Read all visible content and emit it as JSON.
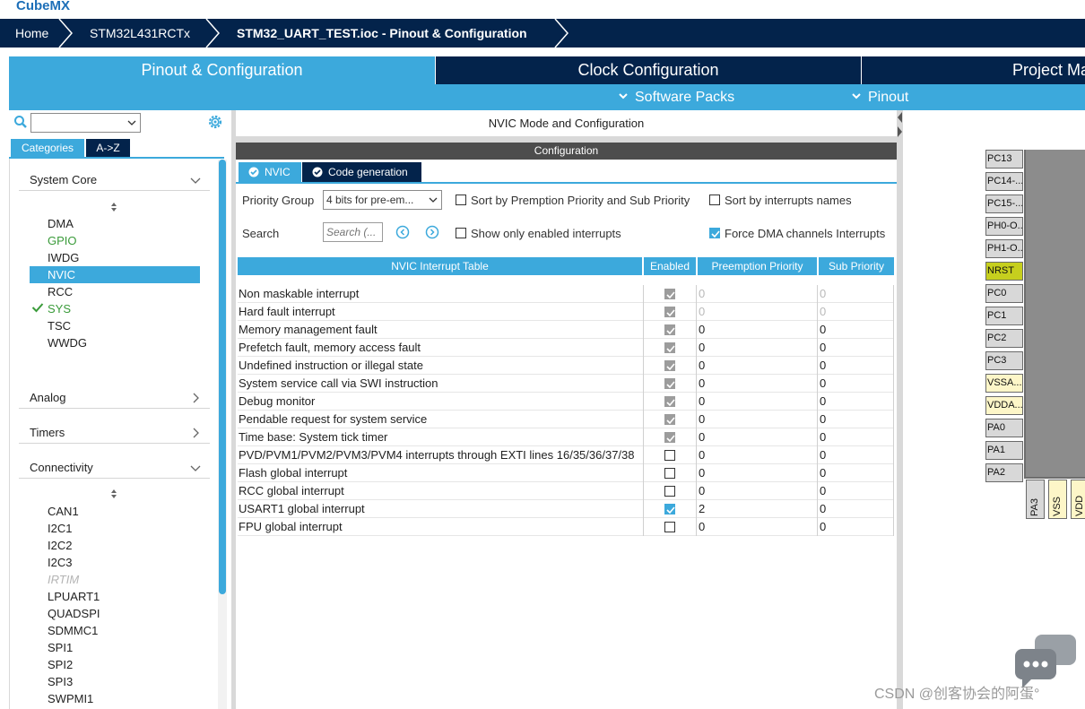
{
  "app": {
    "logo_text": "CubeMX"
  },
  "breadcrumb": {
    "home": "Home",
    "device": "STM32L431RCTx",
    "file": "STM32_UART_TEST.ioc - Pinout & Configuration"
  },
  "main_tabs": [
    {
      "label": "Pinout & Configuration",
      "active": true
    },
    {
      "label": "Clock Configuration",
      "active": false
    },
    {
      "label": "Project Ma",
      "active": false
    }
  ],
  "sub_menu": {
    "software_packs": "Software Packs",
    "pinout": "Pinout"
  },
  "left": {
    "tabs": {
      "categories": "Categories",
      "az": "A->Z"
    },
    "sections": {
      "system_core": "System Core",
      "analog": "Analog",
      "timers": "Timers",
      "connectivity": "Connectivity"
    },
    "system_core_items": [
      "DMA",
      "GPIO",
      "IWDG",
      "NVIC",
      "RCC",
      "SYS",
      "TSC",
      "WWDG"
    ],
    "connectivity_items": [
      "CAN1",
      "I2C1",
      "I2C2",
      "I2C3",
      "IRTIM",
      "LPUART1",
      "QUADSPI",
      "SDMMC1",
      "SPI1",
      "SPI2",
      "SPI3",
      "SWPMI1"
    ]
  },
  "center": {
    "mode_title": "NVIC Mode and Configuration",
    "config_title": "Configuration",
    "tabs": {
      "nvic": "NVIC",
      "codegen": "Code generation"
    },
    "priority_group_label": "Priority Group",
    "priority_group_value": "4 bits for pre-em...",
    "search_label": "Search",
    "search_placeholder": "Search (...",
    "options": {
      "sort_premption": {
        "label": "Sort by Premption Priority and Sub Priority",
        "checked": false
      },
      "sort_names": {
        "label": "Sort by interrupts names",
        "checked": false
      },
      "show_enabled": {
        "label": "Show only enabled interrupts",
        "checked": false
      },
      "force_dma": {
        "label": "Force DMA channels Interrupts",
        "checked": true
      }
    },
    "table": {
      "headers": [
        "NVIC Interrupt Table",
        "Enabled",
        "Preemption Priority",
        "Sub Priority"
      ],
      "rows": [
        {
          "name": "Non maskable interrupt",
          "enabled": "locked",
          "preempt": "0",
          "sub": "0",
          "muted": true
        },
        {
          "name": "Hard fault interrupt",
          "enabled": "locked",
          "preempt": "0",
          "sub": "0",
          "muted": true
        },
        {
          "name": "Memory management fault",
          "enabled": "locked",
          "preempt": "0",
          "sub": "0",
          "muted": false
        },
        {
          "name": "Prefetch fault, memory access fault",
          "enabled": "locked",
          "preempt": "0",
          "sub": "0",
          "muted": false
        },
        {
          "name": "Undefined instruction or illegal state",
          "enabled": "locked",
          "preempt": "0",
          "sub": "0",
          "muted": false
        },
        {
          "name": "System service call via SWI instruction",
          "enabled": "locked",
          "preempt": "0",
          "sub": "0",
          "muted": false
        },
        {
          "name": "Debug monitor",
          "enabled": "locked",
          "preempt": "0",
          "sub": "0",
          "muted": false
        },
        {
          "name": "Pendable request for system service",
          "enabled": "locked",
          "preempt": "0",
          "sub": "0",
          "muted": false
        },
        {
          "name": "Time base: System tick timer",
          "enabled": "locked",
          "preempt": "0",
          "sub": "0",
          "muted": false
        },
        {
          "name": "PVD/PVM1/PVM2/PVM3/PVM4 interrupts through EXTI lines 16/35/36/37/38",
          "enabled": "off",
          "preempt": "0",
          "sub": "0",
          "muted": false
        },
        {
          "name": "Flash global interrupt",
          "enabled": "off",
          "preempt": "0",
          "sub": "0",
          "muted": false
        },
        {
          "name": "RCC global interrupt",
          "enabled": "off",
          "preempt": "0",
          "sub": "0",
          "muted": false
        },
        {
          "name": "USART1 global interrupt",
          "enabled": "on",
          "preempt": "2",
          "sub": "0",
          "muted": false
        },
        {
          "name": "FPU global interrupt",
          "enabled": "off",
          "preempt": "0",
          "sub": "0",
          "muted": false
        }
      ]
    }
  },
  "pinout": {
    "left_pins": [
      {
        "label": "PC13",
        "style": "gray"
      },
      {
        "label": "PC14-...",
        "style": "gray"
      },
      {
        "label": "PC15-...",
        "style": "gray"
      },
      {
        "label": "PH0-O...",
        "style": "gray"
      },
      {
        "label": "PH1-O...",
        "style": "gray"
      },
      {
        "label": "NRST",
        "style": "yellow"
      },
      {
        "label": "PC0",
        "style": "gray"
      },
      {
        "label": "PC1",
        "style": "gray"
      },
      {
        "label": "PC2",
        "style": "gray"
      },
      {
        "label": "PC3",
        "style": "gray"
      },
      {
        "label": "VSSA...",
        "style": "cream"
      },
      {
        "label": "VDDA...",
        "style": "cream"
      },
      {
        "label": "PA0",
        "style": "gray"
      },
      {
        "label": "PA1",
        "style": "gray"
      },
      {
        "label": "PA2",
        "style": "gray"
      }
    ],
    "bottom_pins": [
      {
        "label": "PA3",
        "style": "gray"
      },
      {
        "label": "VSS",
        "style": "cream"
      },
      {
        "label": "VDD",
        "style": "cream"
      }
    ]
  },
  "watermark": "CSDN @创客协会的阿蛋°",
  "colors": {
    "accent": "#3ca9dc",
    "navy": "#03234b",
    "green": "#3a9b3a",
    "pin_yellow": "#c6cf1e"
  }
}
